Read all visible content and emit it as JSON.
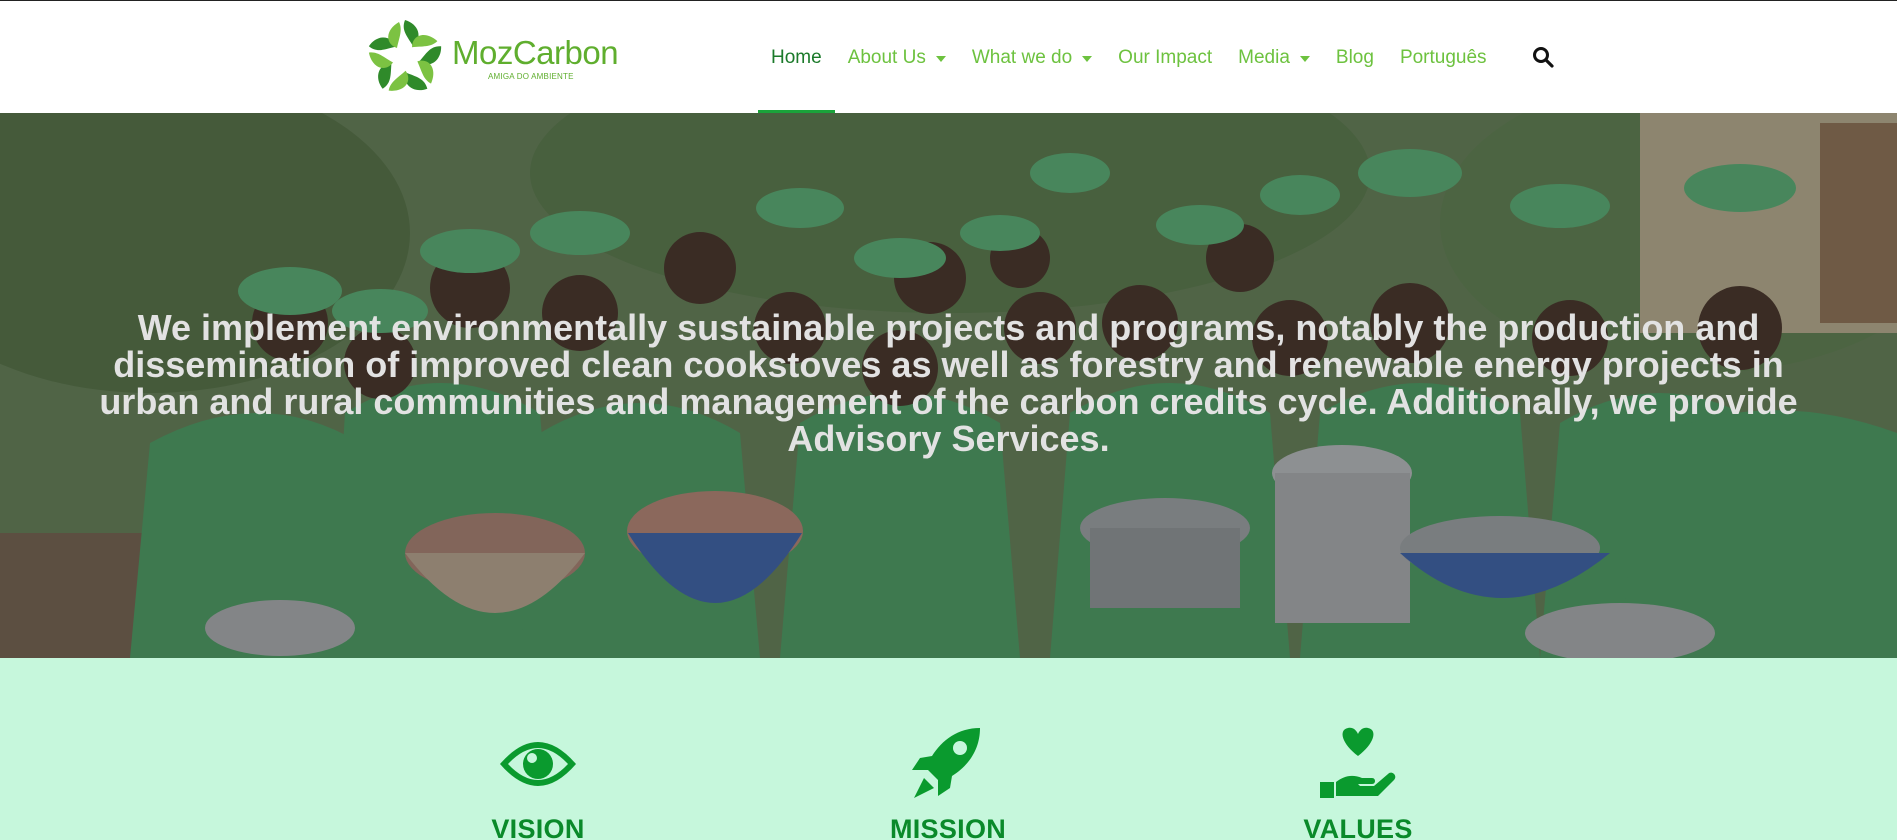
{
  "brand": {
    "name": "MozCarbon",
    "tagline": "AMIGA DO AMBIENTE",
    "color": "#5fae2e"
  },
  "nav": {
    "items": [
      {
        "label": "Home",
        "active": true,
        "dropdown": false
      },
      {
        "label": "About Us",
        "active": false,
        "dropdown": true
      },
      {
        "label": "What we do",
        "active": false,
        "dropdown": true
      },
      {
        "label": "Our Impact",
        "active": false,
        "dropdown": false
      },
      {
        "label": "Media",
        "active": false,
        "dropdown": true
      },
      {
        "label": "Blog",
        "active": false,
        "dropdown": false
      },
      {
        "label": "Português",
        "active": false,
        "dropdown": false
      }
    ],
    "search_icon": "search-icon",
    "link_color": "#6dc23f",
    "active_color": "#1b7a2a"
  },
  "hero": {
    "text": "We implement environmentally sustainable projects and programs, notably the production and dissemination of improved clean cookstoves as well as forestry and renewable energy projects in urban and rural communities and management of the carbon credits cycle. Additionally, we provide Advisory Services."
  },
  "values_section": {
    "background": "#c6f7dc",
    "items": [
      {
        "title": "VISION",
        "icon": "eye-icon"
      },
      {
        "title": "MISSION",
        "icon": "rocket-icon"
      },
      {
        "title": "VALUES",
        "icon": "hand-holding-heart-icon"
      }
    ]
  }
}
